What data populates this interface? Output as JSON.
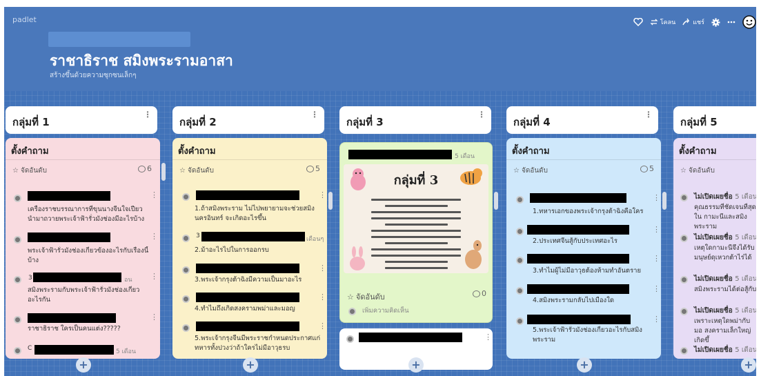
{
  "brand": "padlet",
  "board": {
    "title": "ราชาธิราช สมิงพระรามอาสา",
    "subtitle": "สร้างขึ้นด้วยความซุกซนเล็กๆ"
  },
  "toolbar": {
    "remake_label": "โคลน",
    "share_label": "แชร์"
  },
  "colors": {
    "board_bg": "#4273b9",
    "pink": "#f9dbe0",
    "yellow": "#fbf1c9",
    "green": "#e3f6c9",
    "blue": "#cfe8fb",
    "purple": "#e7dcf5"
  },
  "icons": [
    "heart-icon",
    "remake-icon",
    "share-icon",
    "gear-icon",
    "more-icon",
    "smiley-icon",
    "star-icon",
    "comment-icon",
    "plus-icon",
    "avatar"
  ],
  "columns": [
    {
      "title": "กลุ่มที่ 1",
      "card_title": "ตั้งคำถาม",
      "sort": "จัดอันดับ",
      "count": "6",
      "comments": [
        {
          "text": "เครื่องราชบรรณาการที่ขุนนางจีนใจเปียว นำมาถวายพระเจ้าฟ้ารั่วมังช่องมีอะไรบ้าง"
        },
        {
          "text": "พระเจ้าฟ้ารั่วมังช่องเกี่ยวข้องอะไรกับเรื่องนี้บ้าง"
        },
        {
          "text": "สมิงพระรามกับพระเจ้าฟ้ารั่วมังช่องเกี่ยวอะไรกัน"
        },
        {
          "text": "ราชาธิราช ใครเป็นคนแต่ง?????"
        }
      ],
      "side_labels": [
        "3",
        "อน",
        "5 เดือน",
        "C"
      ]
    },
    {
      "title": "กลุ่มที่ 2",
      "card_title": "ตั้งคำถาม",
      "sort": "จัดอันดับ",
      "count": "5",
      "comments": [
        {
          "text": "1.ถ้าสมิงพระราม ไม่ไปพยายามจะช่วยสมิงนครอินทร์ จะเกิดอะไรขึ้น"
        },
        {
          "text": "2.ม้าอะไรไปในการออกรบ"
        },
        {
          "text": "3.พระเจ้ากรุงต้าฉิงมีความเป็นมาอะไร"
        },
        {
          "text": "4.ทำไมถึงเกิดสงครามพม่าและมอญ"
        },
        {
          "text": "5.พระเจ้ากรุงจีนมีพระราชกำหนดประกาศแก่ทหารทั้งปวงว่าถ้าใครไม่มีอาวุธรบ"
        }
      ],
      "side_labels": [
        "3",
        "เดือนๆ"
      ]
    },
    {
      "title": "กลุ่มที่ 3",
      "image_heading": "กลุ่มที่ 3",
      "image_time": "5 เดือน",
      "sort": "จัดอันดับ",
      "count": "0",
      "add_comment": "เพิ่มความคิดเห็น"
    },
    {
      "title": "กลุ่มที่ 4",
      "card_title": "ตั้งคำถาม",
      "sort": "จัดอันดับ",
      "count": "5",
      "comments": [
        {
          "text": "1.ทหารเอกของพระเจ้ากรุงต้าฉิงคือใคร"
        },
        {
          "text": "2.ประเทศจีนสู้กับประเทศอะไร"
        },
        {
          "text": "3.ทำไมผู้ไม่มีอาวุธต้องห้ามทำอันตราย"
        },
        {
          "text": "4.สมิงพระรามกลับไปเมืองใด"
        },
        {
          "text": "5.พระเจ้าฟ้ารั่วมังช่องเกี่ยวอะไรกับสมิงพระราม"
        }
      ]
    },
    {
      "title": "กลุ่มที่ 5",
      "card_title": "ตั้งคำถาม",
      "sort": "จัดอันดับ",
      "anon_posts": [
        {
          "name": "ไม่เปิดเผยชื่อ",
          "time": "5 เดือน",
          "text": "คุณธรรมที่ชัดเจนที่สุดใน กามะนีและสมิงพระราม"
        },
        {
          "name": "ไม่เปิดเผยชื่อ",
          "time": "5 เดือน",
          "text": "เหตุใดกามะนีจึงได้รับ มนุษย์ดุเหวกต้าไร่ได้"
        },
        {
          "name": "ไม่เปิดเผยชื่อ",
          "time": "5 เดือน",
          "text": "สมิงพระรามได้ต่อสู้กับ"
        },
        {
          "name": "ไม่เปิดเผยชื่อ",
          "time": "5 เดือน",
          "text": "เพราะเหตุใดพม่ากับมอ สงครามเล็กใหญ่เกิดขึ้"
        },
        {
          "name": "ไม่เปิดเผยชื่อ",
          "time": "5 เดือน",
          "text": ""
        }
      ]
    }
  ]
}
